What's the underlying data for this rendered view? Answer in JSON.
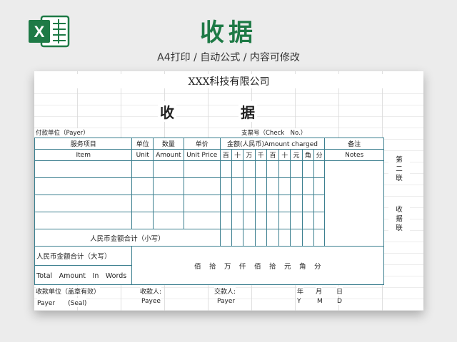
{
  "header": {
    "title": "收据",
    "subtitle": "A4打印 / 自动公式 / 内容可修改",
    "logo_letter": "X"
  },
  "receipt": {
    "company": "XXX科技有限公司",
    "title_left": "收",
    "title_right": "据",
    "payer_label": "付款单位（Payer）",
    "check_label": "支票号（Check　No.）",
    "columns": {
      "item_cn": "服务项目",
      "unit_cn": "单位",
      "qty_cn": "数量",
      "price_cn": "单价",
      "amount_cn": "金额(人民币)",
      "amount_en": "Amount charged",
      "notes_cn": "备注",
      "item_en": "Item",
      "unit_en": "Unit",
      "qty_en": "Amount",
      "price_en": "Unit Price",
      "notes_en": "Notes"
    },
    "digits": [
      "百",
      "十",
      "万",
      "千",
      "百",
      "十",
      "元",
      "角",
      "分"
    ],
    "lowercase_total": "人民币金额合计（小写）",
    "uppercase_total": "人民币金额合计（大写）",
    "total_words_en": "Total　Amount　In　Words",
    "uppercase_units": "佰　拾　万　仟　佰　拾　元　角　分",
    "side_top": "第二联",
    "side_bottom": "收据联",
    "footer": {
      "receiver_unit": "收款单位（盖章有效）",
      "receiver": "收款人:",
      "payer_person": "交款人:",
      "year": "年",
      "month": "月",
      "day": "日",
      "payer_seal": "Payer　　(Seal)",
      "payee": "Payee",
      "payer": "Payer",
      "y": "Y",
      "m": "M",
      "d": "D"
    }
  }
}
